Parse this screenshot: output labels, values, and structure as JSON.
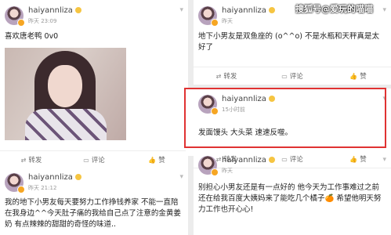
{
  "watermark": "搜狐号@爱玩的喵喵",
  "actions": {
    "repost": "转发",
    "comment": "评论",
    "like": "赞"
  },
  "icons": {
    "repost": "repost-icon",
    "comment": "comment-icon",
    "like": "like-icon",
    "more": "chevron-down-icon"
  },
  "colors": {
    "highlight": "#e03232",
    "verified": "#f6a623"
  },
  "posts": [
    {
      "user": "haiyannliza",
      "time": "昨天 23:09",
      "text": "喜欢唐老鸭 0v0",
      "has_photo": true
    },
    {
      "user": "haiyannliza",
      "time": "昨天 21:12",
      "text": "我的地下小男友每天要努力工作挣钱养家 不能一直陪在我身边^^今天肚子痛的我给自己点了注意的金黄姜奶 有点辣辣的甜甜的奇怪的味道.."
    },
    {
      "user": "haiyannliza",
      "time": "昨天",
      "text": "地下小男友是双鱼座的 (o^^o) 不是水瓶和天秤真是太好了"
    },
    {
      "user": "haiyannliza",
      "time": "15小时前",
      "text": "发面馒头 大头菜 速速反噬。"
    },
    {
      "user": "haiyannliza",
      "time": "昨天",
      "text": "别担心小男友还是有一点好的 他今天为工作事难过之前还在给我百度大姨妈来了能吃几个橘子🍊 希望他明天努力工作也开心心!"
    }
  ]
}
